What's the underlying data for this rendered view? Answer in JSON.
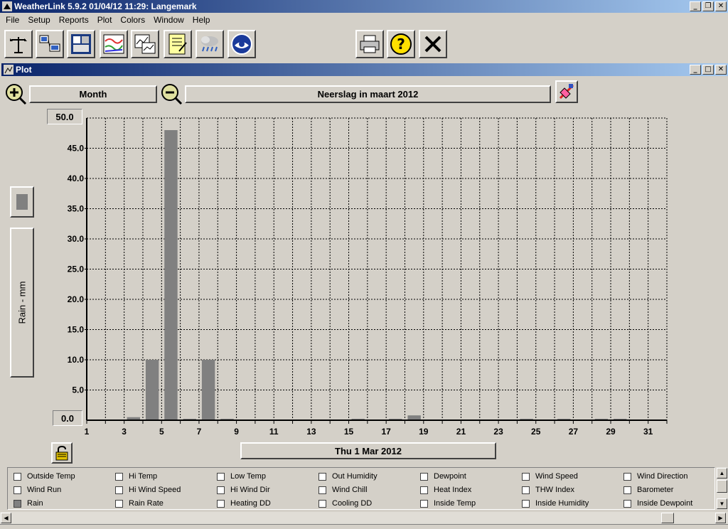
{
  "window": {
    "title": "WeatherLink 5.9.2  01/04/12  11:29: Langemark"
  },
  "menu": [
    "File",
    "Setup",
    "Reports",
    "Plot",
    "Colors",
    "Window",
    "Help"
  ],
  "toolbar": {
    "buttons": [
      "station-icon",
      "download-icon",
      "bulletin-icon",
      "strip-chart-icon",
      "plot-icon",
      "notebook-icon",
      "rain-cloud-icon",
      "noaa-icon",
      "print-icon",
      "help-icon",
      "close-icon"
    ]
  },
  "plot_window": {
    "title": "Plot"
  },
  "controls": {
    "period": "Month",
    "chart_title": "Neerslag in maart 2012",
    "date_label": "Thu 1 Mar 2012",
    "y_max_field": "50.0",
    "y_min_field": "0.0"
  },
  "colors": {
    "bar": "#808080",
    "grid": "#000000",
    "titlebar": "#0a246a"
  },
  "chart_data": {
    "type": "bar",
    "title": "Neerslag in maart 2012",
    "xlabel": "",
    "ylabel": "Rain - mm",
    "ylim": [
      0,
      50
    ],
    "xlim": [
      1,
      32
    ],
    "grid": true,
    "y_ticks": [
      "50.0",
      "45.0",
      "40.0",
      "35.0",
      "30.0",
      "25.0",
      "20.0",
      "15.0",
      "10.0",
      "5.0",
      "0.0"
    ],
    "x_ticks": [
      "1",
      "3",
      "5",
      "7",
      "9",
      "11",
      "13",
      "15",
      "17",
      "19",
      "21",
      "23",
      "25",
      "27",
      "29",
      "31"
    ],
    "categories": [
      "1",
      "2",
      "3",
      "4",
      "5",
      "6",
      "7",
      "8",
      "9",
      "10",
      "11",
      "12",
      "13",
      "14",
      "15",
      "16",
      "17",
      "18",
      "19",
      "20",
      "21",
      "22",
      "23",
      "24",
      "25",
      "26",
      "27",
      "28",
      "29",
      "30",
      "31"
    ],
    "values": [
      0,
      0,
      0.5,
      10,
      48,
      0.2,
      10,
      0.1,
      0,
      0,
      0,
      0,
      0,
      0,
      0.1,
      0,
      0.1,
      0.8,
      0,
      0,
      0,
      0,
      0,
      0.1,
      0,
      0.1,
      0,
      0.1,
      0.1,
      0,
      0
    ]
  },
  "legend": {
    "items": [
      {
        "label": "Outside Temp",
        "checked": false
      },
      {
        "label": "Hi Temp",
        "checked": false
      },
      {
        "label": "Low Temp",
        "checked": false
      },
      {
        "label": "Out Humidity",
        "checked": false
      },
      {
        "label": "Dewpoint",
        "checked": false
      },
      {
        "label": "Wind Speed",
        "checked": false
      },
      {
        "label": "Wind Direction",
        "checked": false
      },
      {
        "label": "Wind Run",
        "checked": false
      },
      {
        "label": "Hi Wind Speed",
        "checked": false
      },
      {
        "label": "Hi Wind Dir",
        "checked": false
      },
      {
        "label": "Wind Chill",
        "checked": false
      },
      {
        "label": "Heat Index",
        "checked": false
      },
      {
        "label": "THW Index",
        "checked": false
      },
      {
        "label": "Barometer",
        "checked": false
      },
      {
        "label": "Rain",
        "checked": true
      },
      {
        "label": "Rain Rate",
        "checked": false
      },
      {
        "label": "Heating DD",
        "checked": false
      },
      {
        "label": "Cooling DD",
        "checked": false
      },
      {
        "label": "Inside Temp",
        "checked": false
      },
      {
        "label": "Inside Humidity",
        "checked": false
      },
      {
        "label": "Inside Dewpoint",
        "checked": false
      }
    ]
  }
}
